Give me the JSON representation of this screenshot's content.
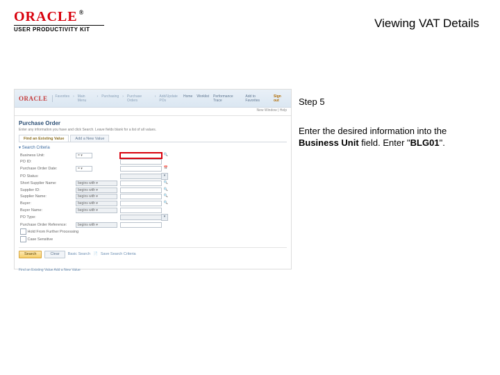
{
  "brand": {
    "logo_text": "ORACLE",
    "trademark": "®",
    "kit_line": "USER PRODUCTIVITY KIT"
  },
  "page": {
    "title": "Viewing VAT Details"
  },
  "instruction": {
    "step_label": "Step 5",
    "body_pre": "Enter the desired information into the ",
    "field_name": "Business Unit",
    "body_mid": " field. Enter \"",
    "value": "BLG01",
    "body_post": "\"."
  },
  "shot": {
    "appbar": {
      "mini_logo": "ORACLE",
      "crumbs": [
        "Favorites",
        "Main Menu",
        "Purchasing",
        "Purchase Orders",
        "Add/Update POs"
      ],
      "nav": [
        "Home",
        "Worklist",
        "Performance Trace",
        "Add to Favorites",
        "Sign out"
      ],
      "subbar": "New Window | Help"
    },
    "page_heading": "Purchase Order",
    "page_desc": "Enter any information you have and click Search. Leave fields blank for a list of all values.",
    "tabs": {
      "tab1": "Find an Existing Value",
      "tab2": "Add a New Value"
    },
    "section": "Search Criteria",
    "form": {
      "rows": [
        {
          "label": "Business Unit:",
          "op": "=  ▾",
          "valclass": "md",
          "highlight": true,
          "lookup": true
        },
        {
          "label": "PO ID:",
          "op": "",
          "valclass": "md",
          "highlight": false,
          "lookup": false
        },
        {
          "label": "Purchase Order Date:",
          "op": "=  ▾",
          "valclass": "md",
          "highlight": false,
          "lookup": true
        },
        {
          "label": "PO Status:",
          "op": "",
          "valclass": "md gray",
          "highlight": false,
          "lookup": false
        },
        {
          "label": "Short Supplier Name:",
          "op": "begins with ▾",
          "valclass": "md",
          "highlight": false,
          "lookup": true
        },
        {
          "label": "Supplier ID:",
          "op": "begins with ▾",
          "valclass": "md",
          "highlight": false,
          "lookup": true
        },
        {
          "label": "Supplier Name:",
          "op": "begins with ▾",
          "valclass": "md",
          "highlight": false,
          "lookup": true
        },
        {
          "label": "Buyer:",
          "op": "begins with ▾",
          "valclass": "md",
          "highlight": false,
          "lookup": true
        },
        {
          "label": "Buyer Name:",
          "op": "begins with ▾",
          "valclass": "md",
          "highlight": false,
          "lookup": false
        },
        {
          "label": "PO Type:",
          "op": "",
          "valclass": "md gray",
          "highlight": false,
          "lookup": false
        },
        {
          "label": "Purchase Order Reference:",
          "op": "begins with ▾",
          "valclass": "md",
          "highlight": false,
          "lookup": false
        },
        {
          "label": "Hold From Further Processing",
          "op": "cb",
          "valclass": "",
          "highlight": false,
          "lookup": false
        }
      ],
      "case_label": "Case Sensitive"
    },
    "buttons": {
      "search": "Search",
      "clear": "Clear",
      "basic": "Basic Search",
      "save": "Save Search Criteria"
    },
    "footer": "Find an Existing Value   Add a New Value"
  }
}
